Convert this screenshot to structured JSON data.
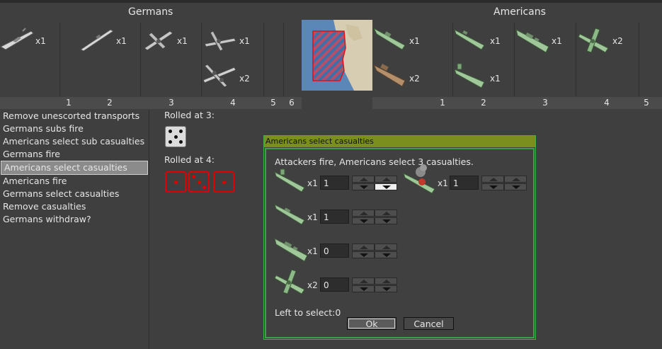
{
  "window": {
    "top_left": "Germans",
    "top_right": "Americans"
  },
  "germans": {
    "units": [
      {
        "icon": "battleship-icon",
        "count": "x1"
      },
      {
        "icon": "submarine-icon",
        "count": "x1"
      },
      {
        "icon": "fighter-icon",
        "count": "x1"
      },
      {
        "icon": "fighter-icon",
        "count": "x1"
      },
      {
        "icon": "bomber-icon",
        "count": "x2"
      }
    ],
    "roll_columns": [
      "1",
      "2",
      "3",
      "4",
      "5",
      "6"
    ]
  },
  "americans": {
    "units": [
      {
        "icon": "destroyer-icon",
        "count": "x1"
      },
      {
        "icon": "transport-icon",
        "count": "x2"
      },
      {
        "icon": "submarine-icon",
        "count": "x1"
      },
      {
        "icon": "destroyer-icon",
        "count": "x1"
      },
      {
        "icon": "battleship-icon",
        "count": "x1"
      },
      {
        "icon": "fighter-icon",
        "count": "x2"
      }
    ],
    "roll_columns": [
      "1",
      "2",
      "3",
      "4",
      "5"
    ]
  },
  "battle_steps": [
    "Remove unescorted transports",
    "Germans subs fire",
    "Americans select sub casualties",
    "Germans fire",
    "Americans select casualties",
    "Americans fire",
    "Germans select casualties",
    "Remove casualties",
    "Germans withdraw?"
  ],
  "selected_step": "Americans select casualties",
  "rolls": [
    {
      "label": "Rolled at 3:",
      "dice": [
        5
      ]
    },
    {
      "label": "Rolled at 4:",
      "dice": [
        1,
        3,
        1
      ]
    }
  ],
  "dialog": {
    "title": "Americans select casualties",
    "message": "Attackers fire, Americans select 3 casualties.",
    "rows": [
      {
        "icon": "submarine-icon",
        "count": "x1",
        "value": "1"
      },
      {
        "icon": "damaged-submarine-icon",
        "count": "x1",
        "value": "1"
      },
      {
        "icon": "destroyer-icon",
        "count": "x1",
        "value": "1"
      },
      {
        "icon": "battleship-icon",
        "count": "x1",
        "value": "0"
      },
      {
        "icon": "fighter-icon",
        "count": "x2",
        "value": "0"
      }
    ],
    "left_to_select": "Left to select:0",
    "ok": "Ok",
    "cancel": "Cancel"
  },
  "colors": {
    "german_unit": "#d8d8d8",
    "american_unit": "#9fc79a",
    "transport_unit": "#b58f6a",
    "dialog_title": "#7a8f1e",
    "dialog_border": "#3aa04a",
    "die_red": "#e00000"
  }
}
